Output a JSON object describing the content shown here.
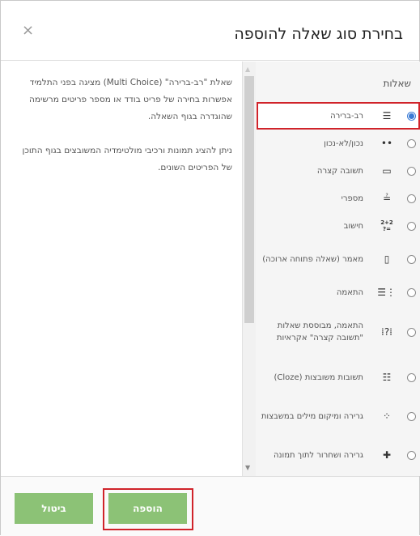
{
  "dialog": {
    "title": "בחירת סוג שאלה להוספה",
    "close_symbol": "×"
  },
  "description": {
    "paragraph1": "שאלת \"רב-ברירה\" (Multi Choice) מציגה בפני התלמיד אפשרות בחירה של פריט בודד או מספר פריטים מרשימה שהוגדרה בגוף השאלה.",
    "paragraph2": "ניתן להציג תמונות ורכיבי מולטימדיה המשובצים בגוף התוכן של הפריטים השונים."
  },
  "question_list": {
    "title": "שאלות",
    "items": [
      {
        "label": "רב-ברירה",
        "icon": "☰",
        "icon_name": "multichoice-icon",
        "selected": true
      },
      {
        "label": "נכון/לא-נכון",
        "icon": "••",
        "icon_name": "truefalse-icon",
        "selected": false
      },
      {
        "label": "תשובה קצרה",
        "icon": "▭",
        "icon_name": "shortanswer-icon",
        "selected": false
      },
      {
        "label": "מספרי",
        "icon": "≟",
        "icon_name": "numerical-icon",
        "selected": false
      },
      {
        "label": "חישוב",
        "icon": "2+2\n=?",
        "icon_name": "calculated-icon",
        "selected": false
      },
      {
        "label": "מאמר (שאלה פתוחה ארוכה)",
        "icon": "▯",
        "icon_name": "essay-icon",
        "selected": false
      },
      {
        "label": "התאמה",
        "icon": "⋮☰",
        "icon_name": "match-icon",
        "selected": false
      },
      {
        "label": "התאמה, מבוססת שאלות \"תשובה קצרה\" אקראיות",
        "icon": "⁞?⁞",
        "icon_name": "randomsamatch-icon",
        "selected": false
      },
      {
        "label": "תשובות משובצות (Cloze)",
        "icon": "☷",
        "icon_name": "cloze-icon",
        "selected": false
      },
      {
        "label": "גרירה ומיקום מילים במשבצות",
        "icon": "⁘",
        "icon_name": "ddwtos-icon",
        "selected": false
      },
      {
        "label": "גרירה ושחרור לתוך תמונה",
        "icon": "✚",
        "icon_name": "ddimageortext-icon",
        "selected": false
      }
    ]
  },
  "footer": {
    "add_label": "הוספה",
    "cancel_label": "ביטול"
  },
  "colors": {
    "button_green": "#8cc276",
    "highlight_red": "#d0232a",
    "radio_blue": "#3a7bd5"
  }
}
